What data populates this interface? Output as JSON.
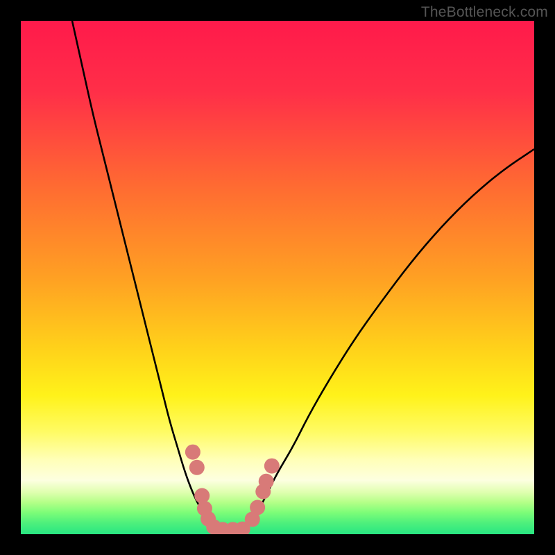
{
  "watermark": "TheBottleneck.com",
  "gradient_stops": [
    {
      "offset": 0,
      "color": "#ff1a4b"
    },
    {
      "offset": 0.14,
      "color": "#ff2f48"
    },
    {
      "offset": 0.32,
      "color": "#ff6a32"
    },
    {
      "offset": 0.5,
      "color": "#ffa023"
    },
    {
      "offset": 0.64,
      "color": "#ffd21a"
    },
    {
      "offset": 0.73,
      "color": "#fff21a"
    },
    {
      "offset": 0.8,
      "color": "#fffb63"
    },
    {
      "offset": 0.855,
      "color": "#ffffb8"
    },
    {
      "offset": 0.895,
      "color": "#fdffe0"
    },
    {
      "offset": 0.918,
      "color": "#e0ffb0"
    },
    {
      "offset": 0.938,
      "color": "#b4ff88"
    },
    {
      "offset": 0.958,
      "color": "#7cfd78"
    },
    {
      "offset": 0.978,
      "color": "#4ef07c"
    },
    {
      "offset": 1.0,
      "color": "#28e682"
    }
  ],
  "chart_data": {
    "type": "line",
    "title": "",
    "xlabel": "",
    "ylabel": "",
    "xlim": [
      0,
      100
    ],
    "ylim": [
      0,
      100
    ],
    "grid": false,
    "legend": false,
    "series": [
      {
        "name": "left-curve",
        "x": [
          10,
          12,
          14,
          16,
          18,
          20,
          22,
          24,
          26,
          27.5,
          29,
          30.5,
          32,
          33.5,
          35,
          36,
          37
        ],
        "values": [
          100,
          91,
          82,
          74,
          66,
          58,
          50,
          42,
          34,
          28,
          22,
          17,
          12,
          8,
          5,
          3,
          1
        ]
      },
      {
        "name": "right-curve",
        "x": [
          44,
          45,
          46.5,
          48,
          50,
          53,
          56,
          60,
          65,
          70,
          76,
          82,
          88,
          94,
          100
        ],
        "values": [
          1,
          3,
          5,
          8,
          12,
          17,
          23,
          30,
          38,
          45,
          53,
          60,
          66,
          71,
          75
        ]
      }
    ],
    "markers": [
      {
        "name": "left-marker-1",
        "x": 33.5,
        "y": 16
      },
      {
        "name": "left-marker-2",
        "x": 34.3,
        "y": 13
      },
      {
        "name": "left-marker-3",
        "x": 35.3,
        "y": 7.5
      },
      {
        "name": "left-marker-4",
        "x": 35.8,
        "y": 5
      },
      {
        "name": "left-marker-5",
        "x": 36.5,
        "y": 3
      },
      {
        "name": "left-marker-6",
        "x": 37.6,
        "y": 1.4
      },
      {
        "name": "left-marker-7",
        "x": 39.3,
        "y": 0.9
      },
      {
        "name": "left-marker-8",
        "x": 41.3,
        "y": 0.9
      },
      {
        "name": "left-marker-9",
        "x": 43.2,
        "y": 1.0
      },
      {
        "name": "right-marker-1",
        "x": 45.1,
        "y": 2.9
      },
      {
        "name": "right-marker-2",
        "x": 46.1,
        "y": 5.2
      },
      {
        "name": "right-marker-3",
        "x": 47.2,
        "y": 8.3
      },
      {
        "name": "right-marker-4",
        "x": 47.8,
        "y": 10.3
      },
      {
        "name": "right-marker-5",
        "x": 48.9,
        "y": 13.3
      }
    ],
    "marker_color": "#d87a78",
    "marker_radius_px": 11
  }
}
